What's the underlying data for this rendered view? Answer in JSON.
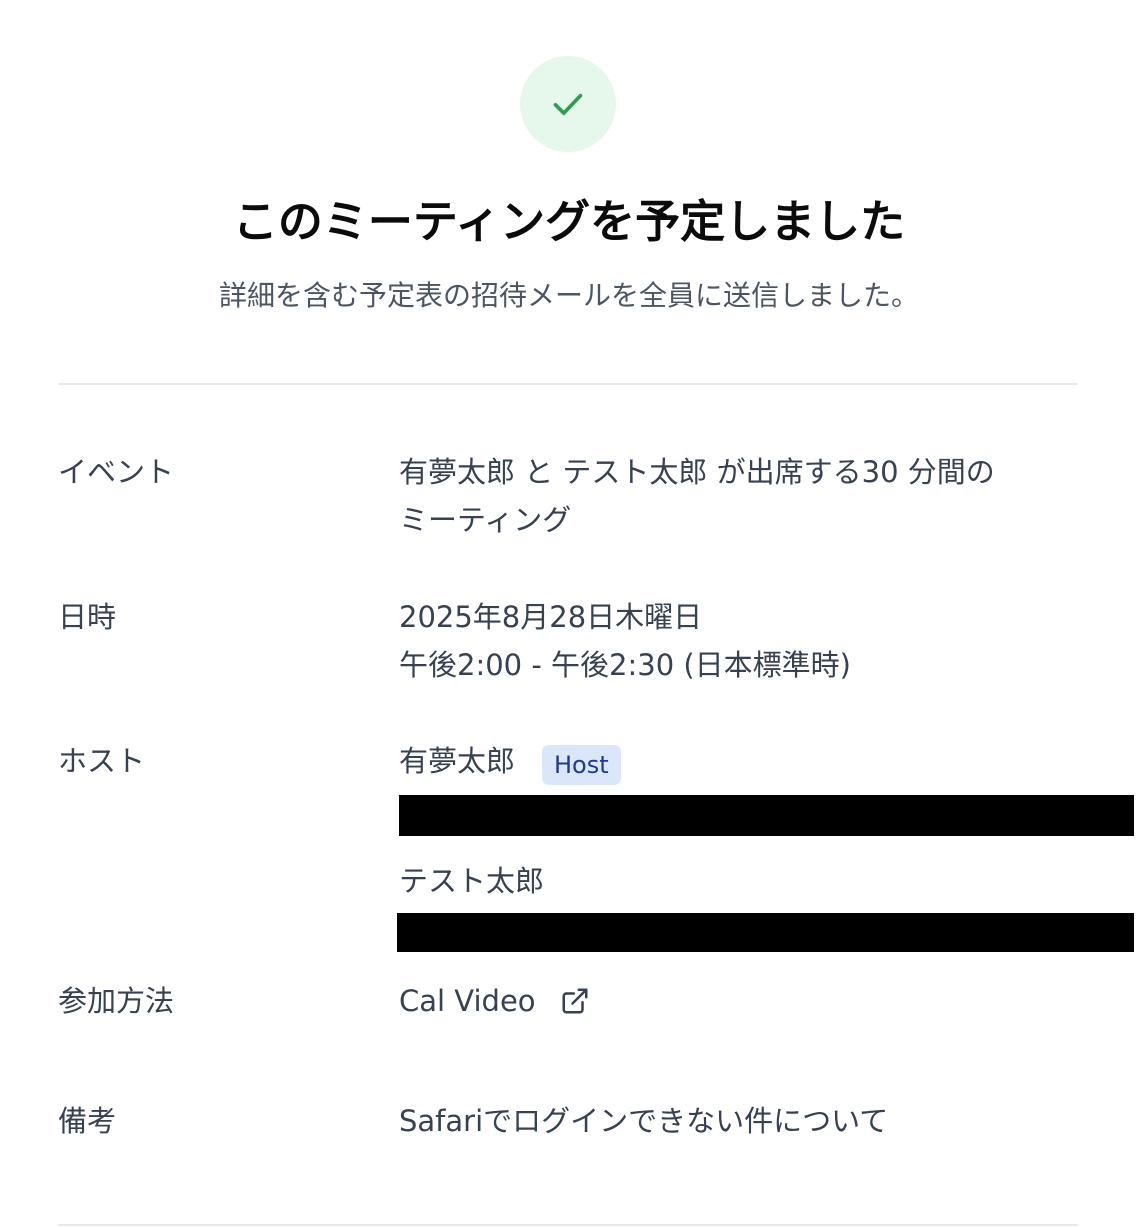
{
  "header": {
    "title": "このミーティングを予定しました",
    "subtitle": "詳細を含む予定表の招待メールを全員に送信しました。"
  },
  "details": {
    "event": {
      "label": "イベント",
      "line1": "有夢太郎 と テスト太郎 が出席する30 分間の",
      "line2": "ミーティング"
    },
    "datetime": {
      "label": "日時",
      "date": "2025年8月28日木曜日",
      "time": "午後2:00 - 午後2:30 (日本標準時)"
    },
    "host": {
      "label": "ホスト",
      "hosts": [
        {
          "name": "有夢太郎",
          "badge": "Host"
        },
        {
          "name": "テスト太郎"
        }
      ]
    },
    "location": {
      "label": "参加方法",
      "value": "Cal Video"
    },
    "notes": {
      "label": "備考",
      "value": "Safariでログインできない件について"
    }
  },
  "colors": {
    "success_bg": "#e6f8ec",
    "success_check": "#2f9e4f",
    "badge_bg": "#dbe6fb",
    "badge_text": "#1e3a8a",
    "divider": "#e5e7eb"
  },
  "icons": {
    "success": "check-icon",
    "location_link": "external-link-icon"
  }
}
